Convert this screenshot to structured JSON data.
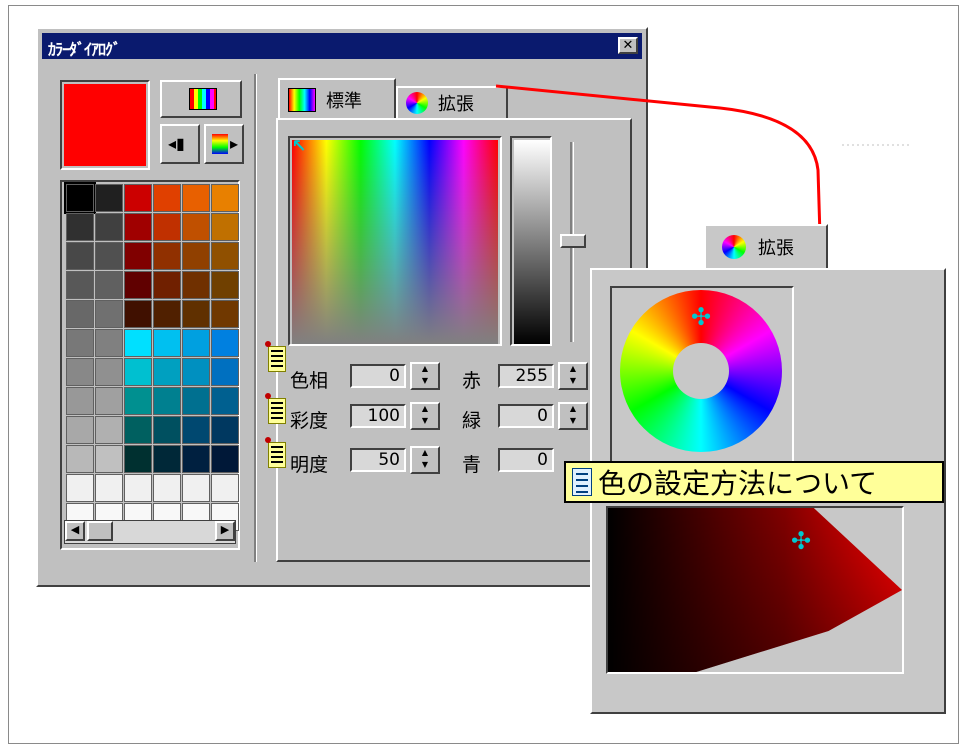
{
  "dialog": {
    "title": "ｶﾗｰﾀﾞｲｱﾛｸﾞ",
    "close_glyph": "✕",
    "current_color": "#ff0000"
  },
  "tabs": [
    {
      "label": "標準",
      "icon": "rainbow-icon"
    },
    {
      "label": "拡張",
      "icon": "color-wheel-icon"
    }
  ],
  "fields": {
    "hue": {
      "label": "色相",
      "value": "0"
    },
    "saturation": {
      "label": "彩度",
      "value": "100"
    },
    "lightness": {
      "label": "明度",
      "value": "50"
    },
    "red": {
      "label": "赤",
      "value": "255"
    },
    "green": {
      "label": "緑",
      "value": "0"
    },
    "blue": {
      "label": "青",
      "value": "0"
    }
  },
  "popup": {
    "tab_label": "拡張"
  },
  "callout": {
    "text": "色の設定方法について"
  },
  "palette": [
    "#000000",
    "#202020",
    "#cc0000",
    "#e04000",
    "#e86000",
    "#e88000",
    "#303030",
    "#404040",
    "#a00000",
    "#c03000",
    "#c05000",
    "#c07000",
    "#484848",
    "#505050",
    "#800000",
    "#903000",
    "#904000",
    "#905000",
    "#585858",
    "#606060",
    "#600000",
    "#702000",
    "#703000",
    "#704000",
    "#686868",
    "#707070",
    "#401000",
    "#502000",
    "#603000",
    "#703800",
    "#787878",
    "#808080",
    "#00e0ff",
    "#00c0f0",
    "#00a0e0",
    "#0080e0",
    "#888888",
    "#909090",
    "#00c0d0",
    "#00a0c0",
    "#0090c0",
    "#0070c0",
    "#989898",
    "#a0a0a0",
    "#009090",
    "#008090",
    "#007090",
    "#006090",
    "#a8a8a8",
    "#b0b0b0",
    "#006060",
    "#005060",
    "#004870",
    "#003860",
    "#b8b8b8",
    "#c0c0c0",
    "#003030",
    "#002838",
    "#002040",
    "#001838",
    "#f0f0f0",
    "#f0f0f0",
    "#f0f0f0",
    "#f0f0f0",
    "#f0f0f0",
    "#f0f0f0",
    "#f8f8f8",
    "#f8f8f8",
    "#f8f8f8",
    "#f8f8f8",
    "#f8f8f8",
    "#f8f8f8"
  ]
}
